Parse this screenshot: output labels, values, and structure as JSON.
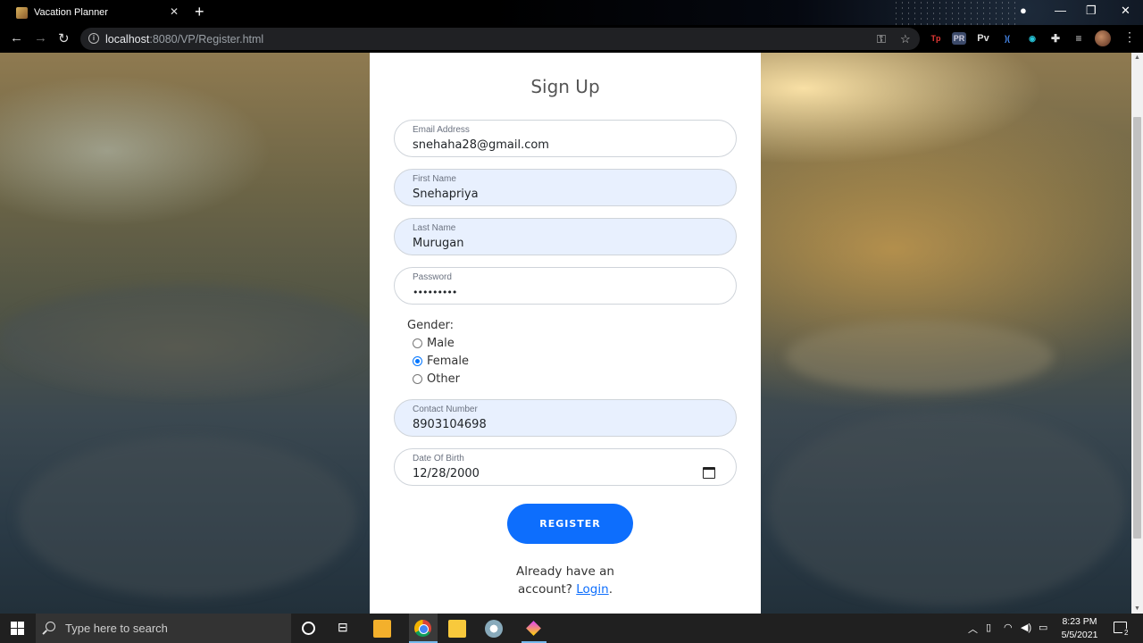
{
  "browser": {
    "tab_title": "Vacation Planner",
    "url_host": "localhost",
    "url_path": ":8080/VP/Register.html"
  },
  "page": {
    "title": "Sign Up",
    "fields": {
      "email": {
        "label": "Email Address",
        "value": "snehaha28@gmail.com"
      },
      "first_name": {
        "label": "First Name",
        "value": "Snehapriya"
      },
      "last_name": {
        "label": "Last Name",
        "value": "Murugan"
      },
      "password": {
        "label": "Password",
        "value": "•••••••••"
      },
      "contact": {
        "label": "Contact Number",
        "value": "8903104698"
      },
      "dob": {
        "label": "Date Of Birth",
        "value": "12/28/2000"
      }
    },
    "gender": {
      "label": "Gender:",
      "options": [
        "Male",
        "Female",
        "Other"
      ],
      "selected": "Female"
    },
    "register_label": "REGISTER",
    "login_prompt_line1": "Already have an",
    "login_prompt_line2": "account?",
    "login_link": "Login",
    "login_trailing": "."
  },
  "taskbar": {
    "search_placeholder": "Type here to search",
    "time": "8:23 PM",
    "date": "5/5/2021",
    "notification_count": "2"
  }
}
